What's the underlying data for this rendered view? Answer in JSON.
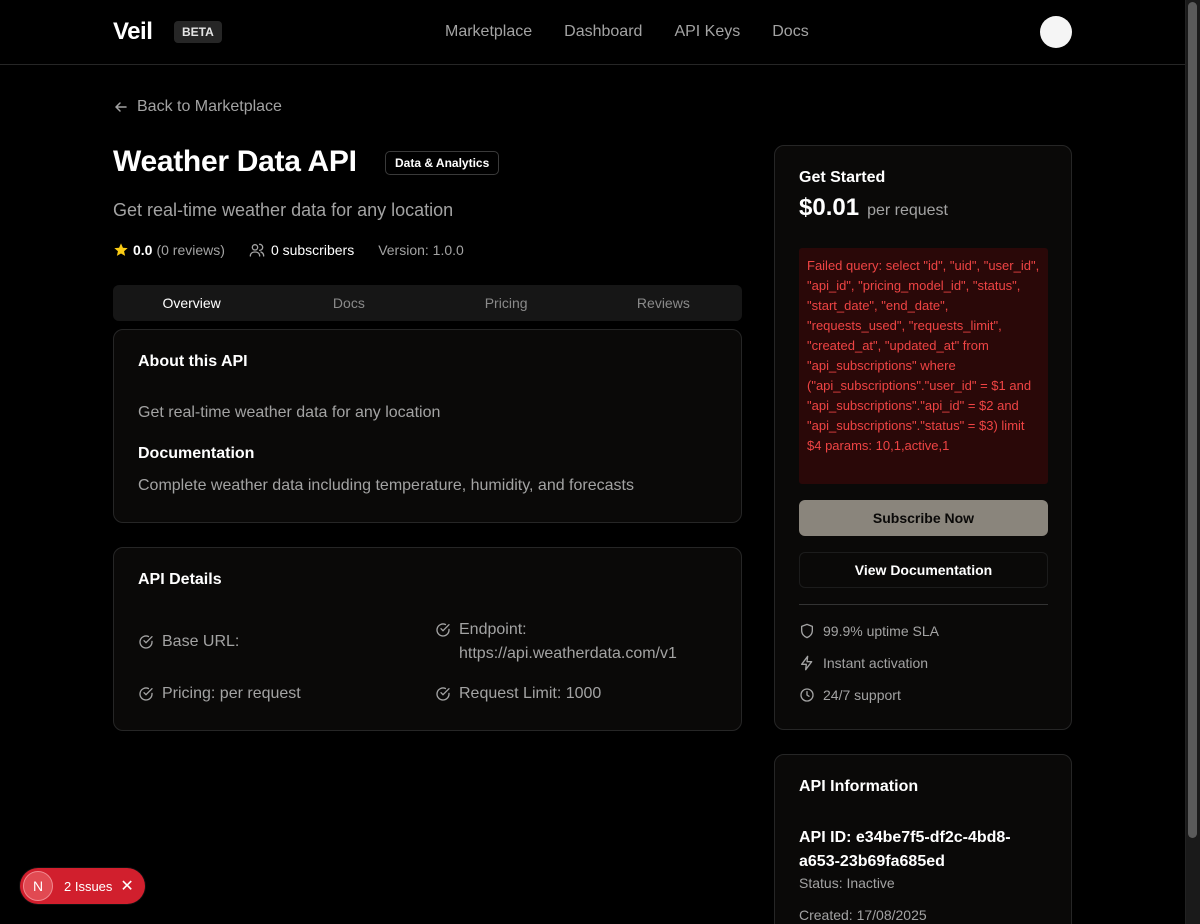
{
  "header": {
    "logo": "Veil",
    "badge": "BETA",
    "nav": [
      "Marketplace",
      "Dashboard",
      "API Keys",
      "Docs"
    ]
  },
  "back_link": "Back to Marketplace",
  "api": {
    "title": "Weather Data API",
    "category": "Data & Analytics",
    "subtitle": "Get real-time weather data for any location",
    "rating": "0.0",
    "reviews": "(0 reviews)",
    "subscribers": "0 subscribers",
    "version": "Version: 1.0.0"
  },
  "tabs": [
    "Overview",
    "Docs",
    "Pricing",
    "Reviews"
  ],
  "about": {
    "heading": "About this API",
    "description": "Get real-time weather data for any location",
    "doc_heading": "Documentation",
    "doc_text": "Complete weather data including temperature, humidity, and forecasts"
  },
  "details": {
    "heading": "API Details",
    "base_url": "Base URL:",
    "endpoint_label": "Endpoint:",
    "endpoint_value": "https://api.weatherdata.com/v1",
    "pricing": "Pricing: per request",
    "limit": "Request Limit: 1000"
  },
  "get_started": {
    "heading": "Get Started",
    "price": "$0.01",
    "unit": "per request",
    "error": "Failed query: select \"id\", \"uid\", \"user_id\", \"api_id\", \"pricing_model_id\", \"status\", \"start_date\", \"end_date\", \"requests_used\", \"requests_limit\", \"created_at\", \"updated_at\" from \"api_subscriptions\" where (\"api_subscriptions\".\"user_id\" = $1 and \"api_subscriptions\".\"api_id\" = $2 and \"api_subscriptions\".\"status\" = $3) limit $4 params: 10,1,active,1",
    "subscribe": "Subscribe Now",
    "view_docs": "View Documentation",
    "features": [
      "99.9% uptime SLA",
      "Instant activation",
      "24/7 support"
    ]
  },
  "info": {
    "heading": "API Information",
    "api_id": "API ID: e34be7f5-df2c-4bd8-a653-23b69fa685ed",
    "status": "Status: Inactive",
    "created": "Created: 17/08/2025"
  },
  "issues": {
    "icon_letter": "N",
    "label": "2 Issues"
  },
  "colors": {
    "background": "#000000",
    "card": "#0a0908",
    "error_text": "#ef4444",
    "error_bg": "#2a0808",
    "subscribe_bg": "#8a857c",
    "issues_badge": "#d11f2d",
    "star": "#facc15"
  }
}
